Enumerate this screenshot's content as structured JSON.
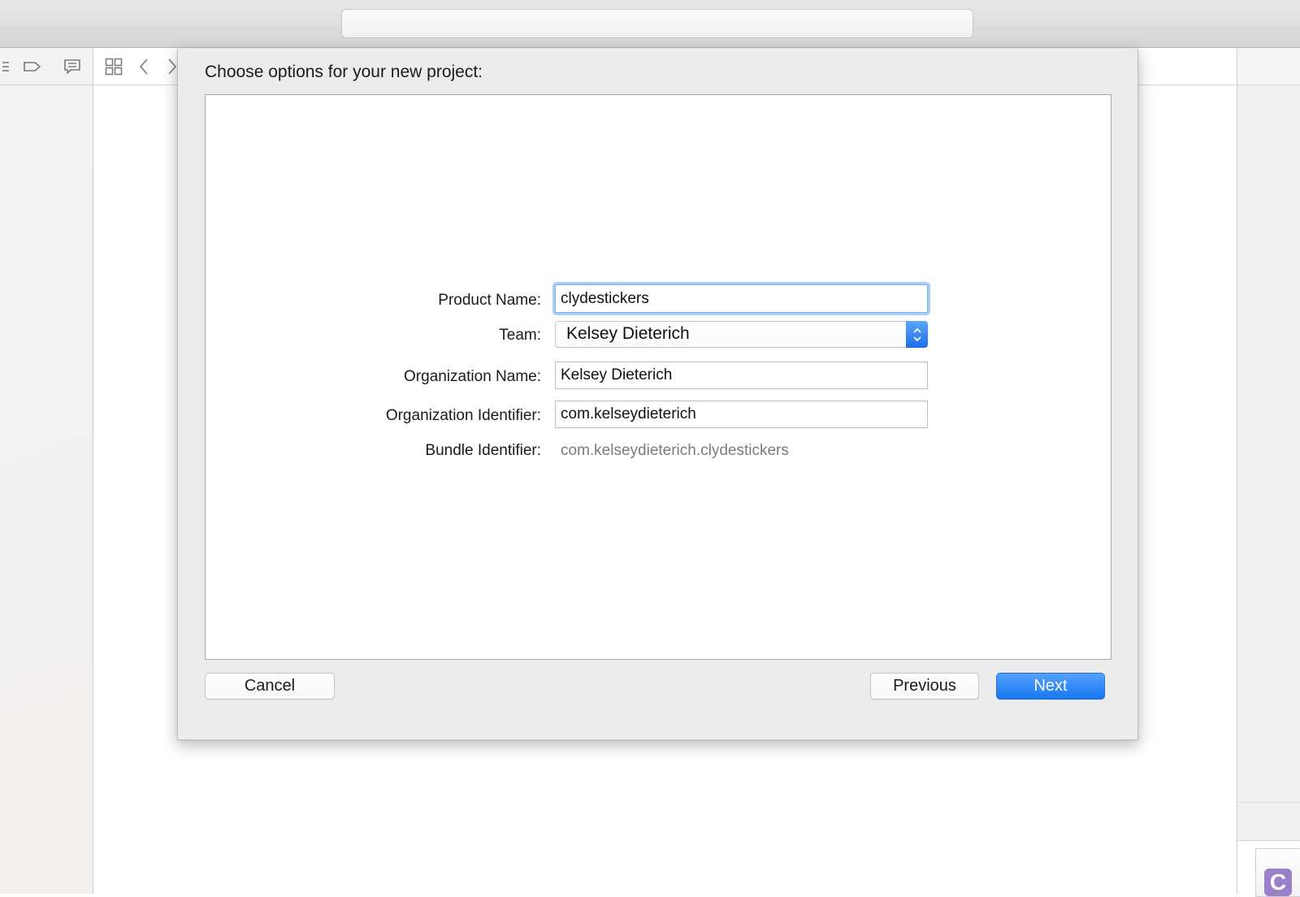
{
  "window": {
    "activity_text": ""
  },
  "toolbar": {
    "icons": [
      "list-icon",
      "tag-icon",
      "comment-icon",
      "grid-icon",
      "back-chevron-icon",
      "forward-chevron-icon"
    ]
  },
  "dialog": {
    "title": "Choose options for your new project:",
    "fields": {
      "product_name": {
        "label": "Product Name:",
        "value": "clydestickers"
      },
      "team": {
        "label": "Team:",
        "value": "Kelsey Dieterich"
      },
      "organization_name": {
        "label": "Organization Name:",
        "value": "Kelsey Dieterich"
      },
      "organization_identifier": {
        "label": "Organization Identifier:",
        "value": "com.kelseydieterich"
      },
      "bundle_identifier": {
        "label": "Bundle Identifier:",
        "value": "com.kelseydieterich.clydestickers"
      }
    },
    "buttons": {
      "cancel": "Cancel",
      "previous": "Previous",
      "next": "Next"
    }
  },
  "right_pane": {
    "file_badge": "C"
  },
  "colors": {
    "accent": "#1777f0",
    "focus_ring": "#a9cdf5",
    "file_badge": "#9a80c9"
  }
}
